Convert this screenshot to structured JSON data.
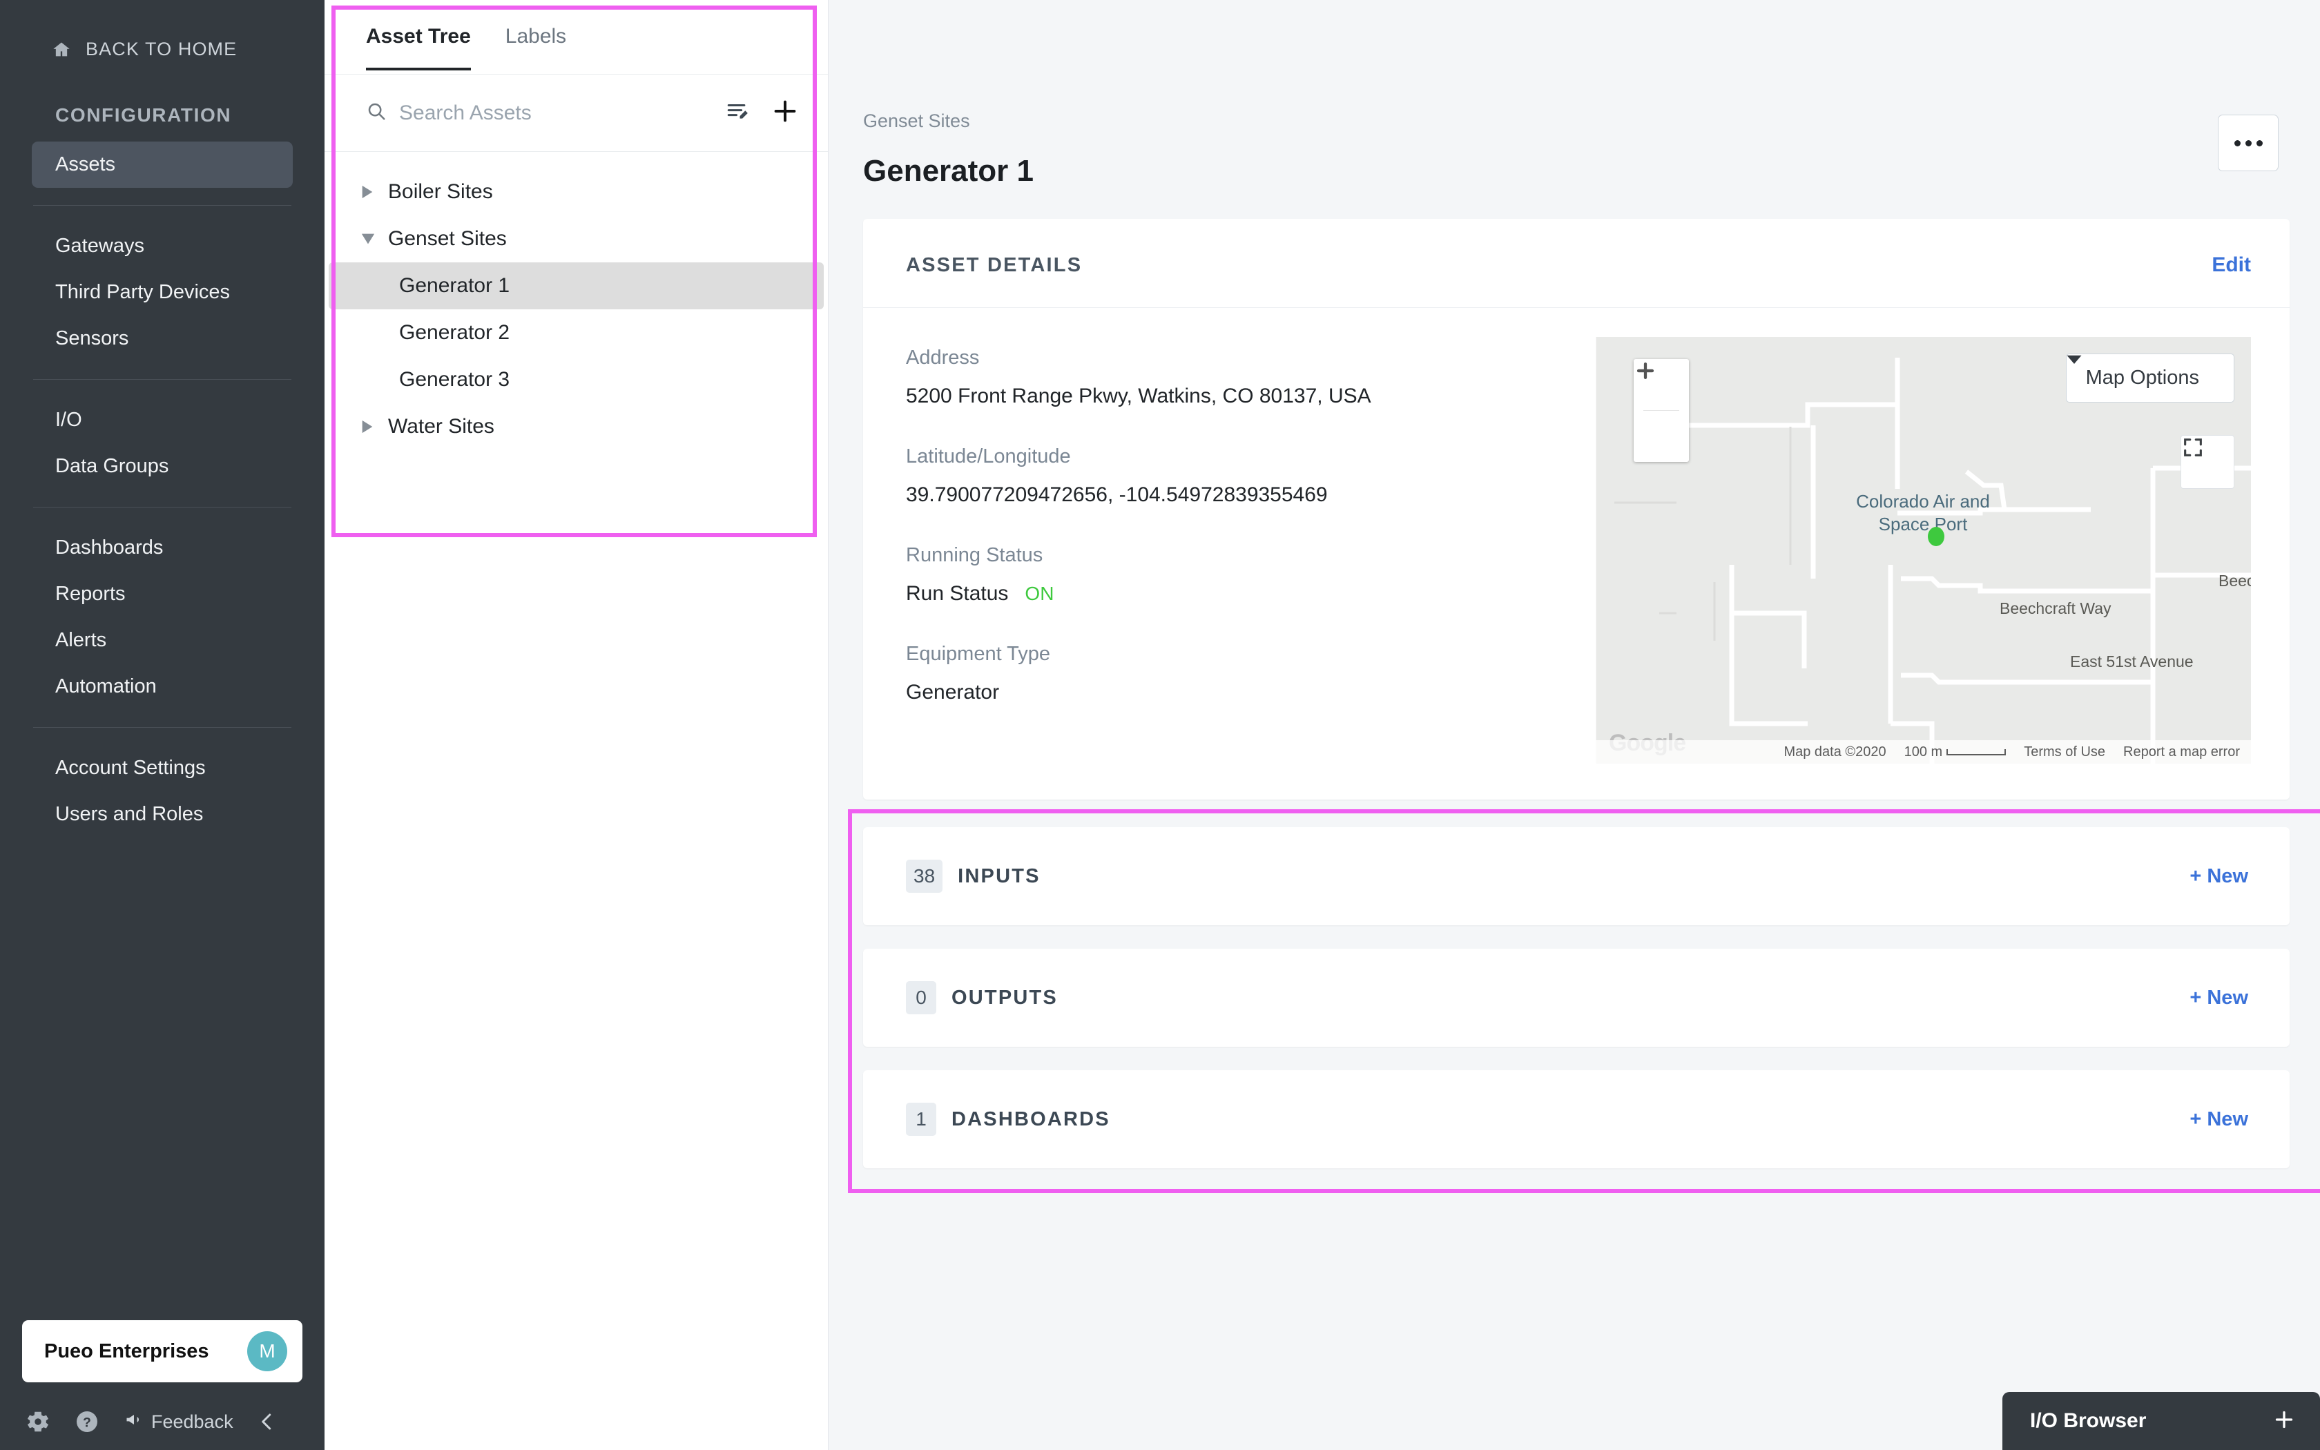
{
  "sidebar": {
    "back_home": "BACK TO HOME",
    "section_label": "CONFIGURATION",
    "groups": [
      {
        "items": [
          {
            "label": "Assets",
            "active": true
          }
        ]
      },
      {
        "items": [
          {
            "label": "Gateways"
          },
          {
            "label": "Third Party Devices"
          },
          {
            "label": "Sensors"
          }
        ]
      },
      {
        "items": [
          {
            "label": "I/O"
          },
          {
            "label": "Data Groups"
          }
        ]
      },
      {
        "items": [
          {
            "label": "Dashboards"
          },
          {
            "label": "Reports"
          },
          {
            "label": "Alerts"
          },
          {
            "label": "Automation"
          }
        ]
      },
      {
        "items": [
          {
            "label": "Account Settings"
          },
          {
            "label": "Users and Roles"
          }
        ]
      }
    ],
    "org_name": "Pueo Enterprises",
    "org_initial": "M",
    "feedback_label": "Feedback"
  },
  "tree_panel": {
    "tabs": [
      {
        "label": "Asset Tree",
        "active": true
      },
      {
        "label": "Labels",
        "active": false
      }
    ],
    "search_placeholder": "Search Assets",
    "search_value": "",
    "nodes": [
      {
        "label": "Boiler Sites",
        "level": 0,
        "state": "collapsed",
        "selected": false
      },
      {
        "label": "Genset Sites",
        "level": 0,
        "state": "expanded",
        "selected": false
      },
      {
        "label": "Generator 1",
        "level": 1,
        "state": "leaf",
        "selected": true
      },
      {
        "label": "Generator 2",
        "level": 1,
        "state": "leaf",
        "selected": false
      },
      {
        "label": "Generator 3",
        "level": 1,
        "state": "leaf",
        "selected": false
      },
      {
        "label": "Water Sites",
        "level": 0,
        "state": "collapsed",
        "selected": false
      }
    ]
  },
  "main": {
    "breadcrumb": "Genset Sites",
    "title": "Generator 1",
    "details": {
      "heading": "ASSET DETAILS",
      "edit_label": "Edit",
      "address_label": "Address",
      "address_value": "5200 Front Range Pkwy, Watkins, CO 80137, USA",
      "latlng_label": "Latitude/Longitude",
      "latlng_value": "39.790077209472656, -104.54972839355469",
      "running_status_label": "Running Status",
      "run_status_label": "Run Status",
      "run_status_value": "ON",
      "equipment_type_label": "Equipment Type",
      "equipment_type_value": "Generator"
    },
    "map": {
      "options_label": "Map Options",
      "poi_label": "Colorado Air and Space Port",
      "streets": [
        "Beechcraft Way",
        "East 51st Avenue",
        "Beechc"
      ],
      "watermark": "Google",
      "attribution": "Map data ©2020",
      "scale": "100 m",
      "terms": "Terms of Use",
      "report": "Report a map error"
    },
    "sections": [
      {
        "count": "38",
        "title": "INPUTS",
        "action": "+ New"
      },
      {
        "count": "0",
        "title": "OUTPUTS",
        "action": "+ New"
      },
      {
        "count": "1",
        "title": "DASHBOARDS",
        "action": "+ New"
      }
    ]
  },
  "io_browser": {
    "title": "I/O Browser"
  },
  "colors": {
    "highlight": "#ef5ff0",
    "accent_link": "#3b72d9",
    "status_on": "#3ec93e",
    "sidebar_bg": "#343a40",
    "avatar_bg": "#5bb9c4"
  }
}
